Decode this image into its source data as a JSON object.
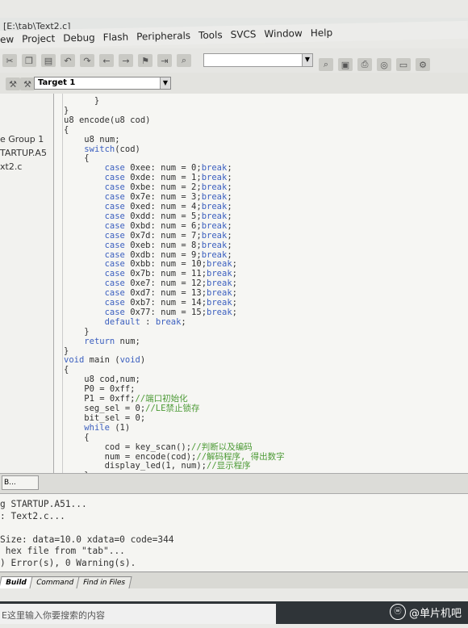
{
  "window": {
    "title": "[E:\\tab\\Text2.c]"
  },
  "menu": [
    "ew",
    "Project",
    "Debug",
    "Flash",
    "Peripherals",
    "Tools",
    "SVCS",
    "Window",
    "Help"
  ],
  "toolbar": {
    "target_label": "Target 1"
  },
  "project_tree": [
    "e Group 1",
    "TARTUP.A5",
    "xt2.c"
  ],
  "editor": {
    "code_lines": [
      "      }",
      "}",
      "u8 encode(u8 cod)",
      "{",
      "    u8 num;",
      "    switch(cod)",
      "    {",
      "        case 0xee: num = 0;break;",
      "        case 0xde: num = 1;break;",
      "        case 0xbe: num = 2;break;",
      "        case 0x7e: num = 3;break;",
      "        case 0xed: num = 4;break;",
      "        case 0xdd: num = 5;break;",
      "        case 0xbd: num = 6;break;",
      "        case 0x7d: num = 7;break;",
      "        case 0xeb: num = 8;break;",
      "        case 0xdb: num = 9;break;",
      "        case 0xbb: num = 10;break;",
      "        case 0x7b: num = 11;break;",
      "        case 0xe7: num = 12;break;",
      "        case 0xd7: num = 13;break;",
      "        case 0xb7: num = 14;break;",
      "        case 0x77: num = 15;break;",
      "        default : break;",
      "    }",
      "    return num;",
      "}",
      "void main (void)",
      "{",
      "    u8 cod,num;",
      "    P0 = 0xff;",
      "    P1 = 0xff;//端口初始化",
      "    seg_sel = 0;//LE禁止锁存",
      "    bit_sel = 0;",
      "    while (1)",
      "    {",
      "        cod = key_scan();//判断以及编码",
      "        num = encode(cod);//解码程序, 得出数字",
      "        display_led(1, num);//显示程序",
      "    }",
      "}"
    ]
  },
  "panel_tab": "B...",
  "output": {
    "lines": [
      "g STARTUP.A51...",
      ": Text2.c...",
      "",
      "Size: data=10.0 xdata=0 code=344",
      " hex file from \"tab\"...",
      ") Error(s), 0 Warning(s)."
    ]
  },
  "bottom_tabs": [
    "Build",
    "Command",
    "Find in Files"
  ],
  "taskbar": {
    "search_placeholder": "E这里输入你要搜索的内容"
  },
  "watermark": {
    "text": "@单片机吧"
  },
  "colors": {
    "keyword": "#3b5fbf",
    "comment": "#4c9a35",
    "text": "#303030"
  }
}
